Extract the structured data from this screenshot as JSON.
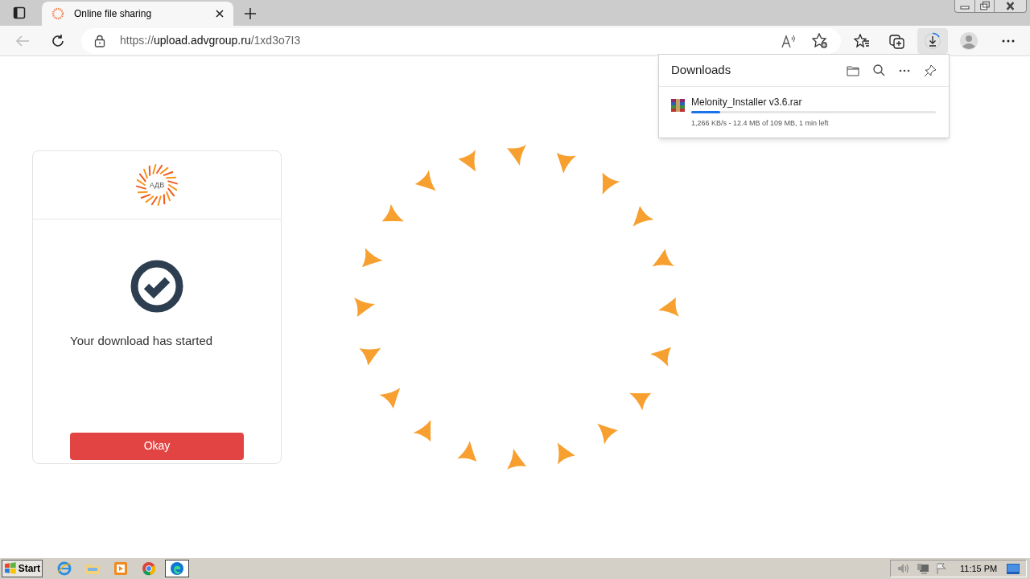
{
  "browser": {
    "tab": {
      "title": "Online file sharing",
      "selected": true
    },
    "url": {
      "scheme": "https://",
      "host": "upload.advgroup.ru",
      "path": "/1xd3o7I3"
    }
  },
  "downloads": {
    "title": "Downloads",
    "items": [
      {
        "name": "Melonity_Installer v3.6.rar",
        "level": 0.12,
        "status": "1,266 KB/s - 12.4 MB of 109 MB, 1 min left"
      }
    ]
  },
  "card": {
    "logo_text": "АДВ",
    "message": "Your download has started",
    "button": "Okay"
  },
  "taskbar": {
    "start": "Start",
    "apps": [
      {
        "kind": "ie",
        "selected": false
      },
      {
        "kind": "folder",
        "selected": false
      },
      {
        "kind": "media",
        "selected": false
      },
      {
        "kind": "chrome",
        "selected": false
      },
      {
        "kind": "edge",
        "selected": true
      }
    ],
    "clock": "11:15 PM"
  }
}
